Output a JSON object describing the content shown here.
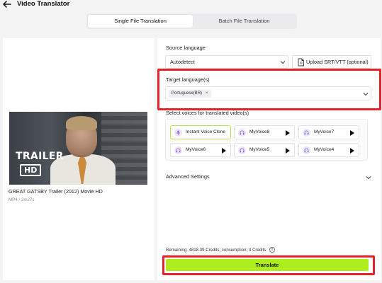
{
  "header": {
    "title": "Video Translator",
    "back_icon": "arrow-left-icon"
  },
  "tabs": [
    {
      "label": "Single File Translation",
      "active": true
    },
    {
      "label": "Batch File Translation",
      "active": false
    }
  ],
  "preview": {
    "thumbnail_text": {
      "trailer": "TRAILER",
      "hd": "HD"
    },
    "title": "GREAT GATSBY Trailer (2012) Movie HD",
    "meta": "MP4 / 2m27s"
  },
  "source": {
    "label": "Source language",
    "value": "Autodetect",
    "upload_label": "Upload SRT/VTT (optional)"
  },
  "target": {
    "label": "Target language(s)",
    "chips": [
      "Portuguese(BR)"
    ]
  },
  "voices": {
    "label": "Select voices for translated video(s)",
    "items": [
      {
        "name": "Instant Voice Clone",
        "selected": true,
        "playable": false
      },
      {
        "name": "MyVoice8",
        "selected": false,
        "playable": true
      },
      {
        "name": "MyVoice7",
        "selected": false,
        "playable": true
      },
      {
        "name": "MyVoice6",
        "selected": false,
        "playable": true
      },
      {
        "name": "MyVoice5",
        "selected": false,
        "playable": true
      },
      {
        "name": "MyVoice4",
        "selected": false,
        "playable": true
      }
    ]
  },
  "advanced": {
    "label": "Advanced Settings"
  },
  "credits": {
    "text": "Remaining: 4818.39 Credits; consumption: 4 Credits"
  },
  "translate": {
    "label": "Translate"
  },
  "colors": {
    "accent": "#aeee1e",
    "highlight": "#e8202a",
    "voice_avatar": "#ece4fb"
  }
}
